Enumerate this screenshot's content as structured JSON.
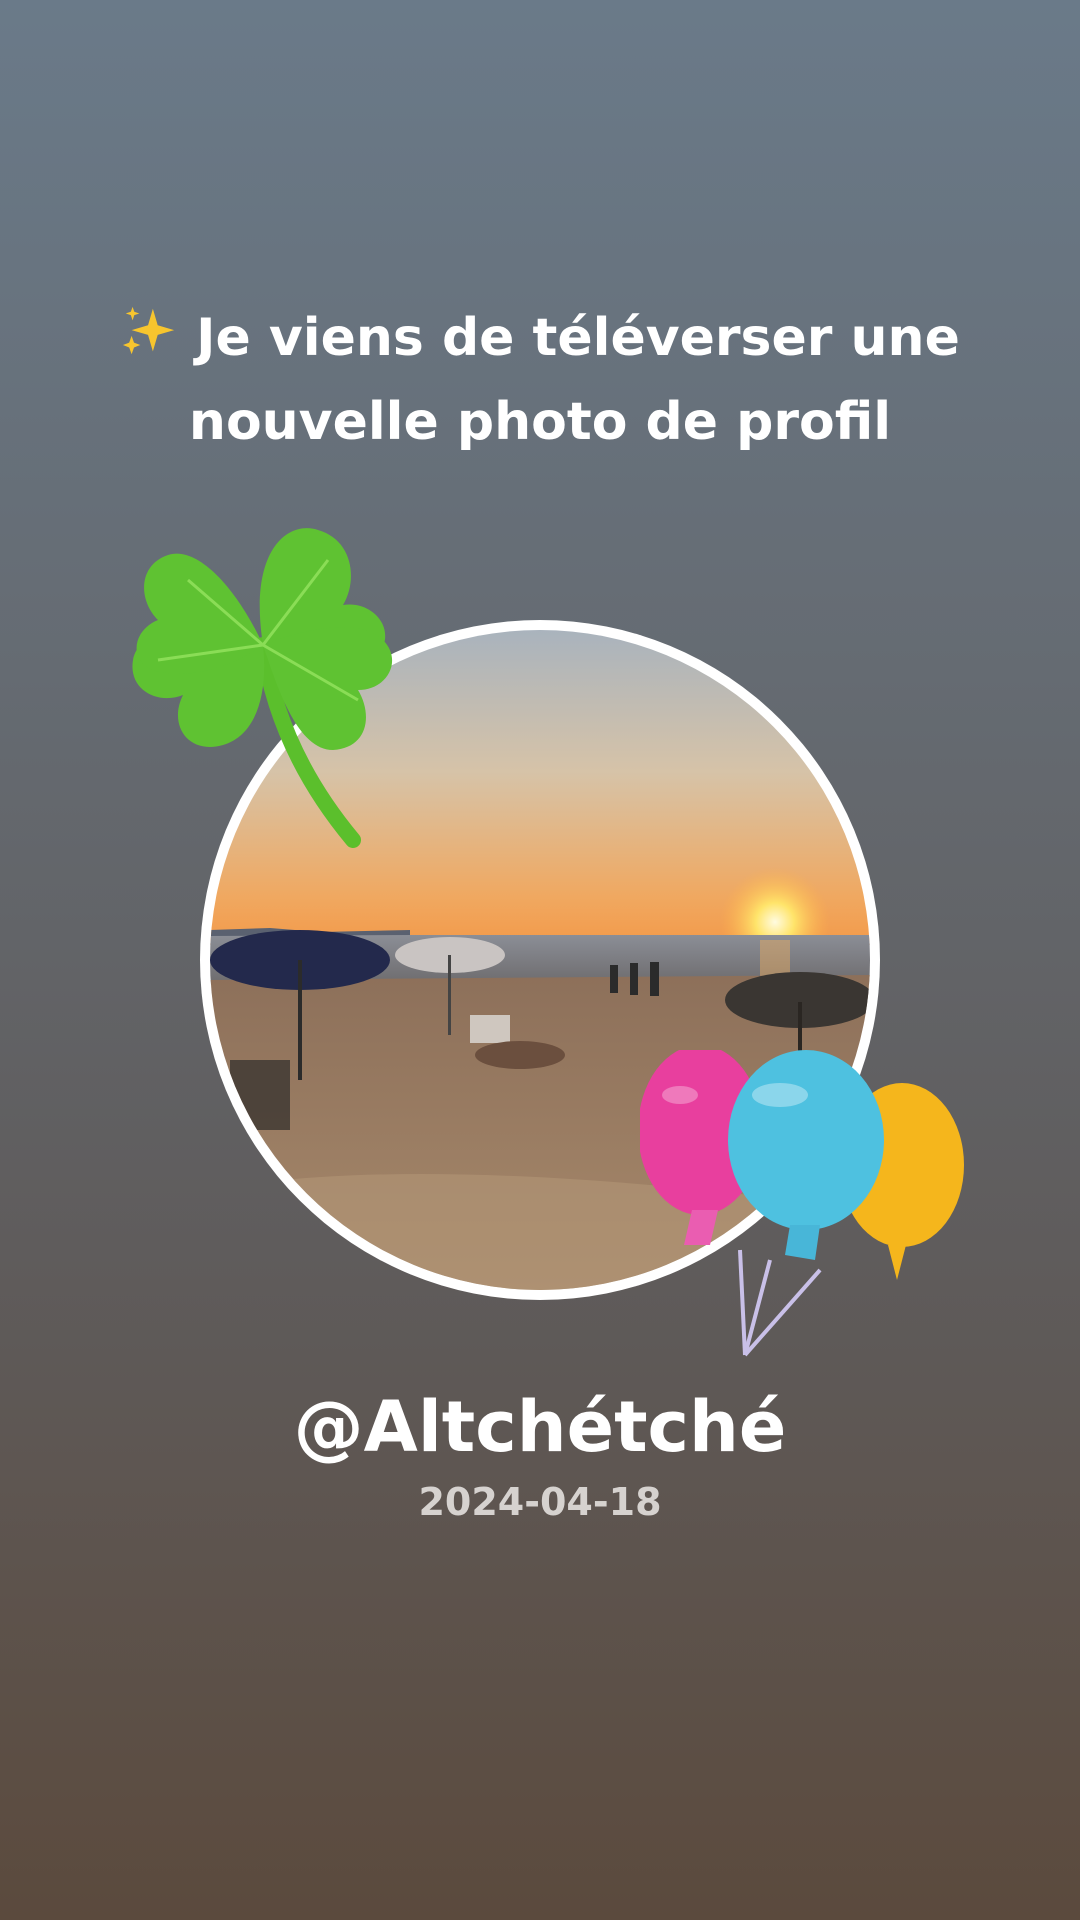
{
  "headline": {
    "emoji": "sparkles-icon",
    "text": "Je viens de téléverser une nouvelle photo de profil"
  },
  "profile": {
    "username": "@Altchétché",
    "date": "2024-04-18"
  },
  "decorations": {
    "top_left": "four-leaf-clover-icon",
    "bottom_right": "balloons-icon"
  },
  "colors": {
    "background_top": "#6a7a89",
    "background_bottom": "#5b4a3d",
    "text": "#ffffff",
    "date_text": "#d6d2cf",
    "ring": "#ffffff"
  }
}
